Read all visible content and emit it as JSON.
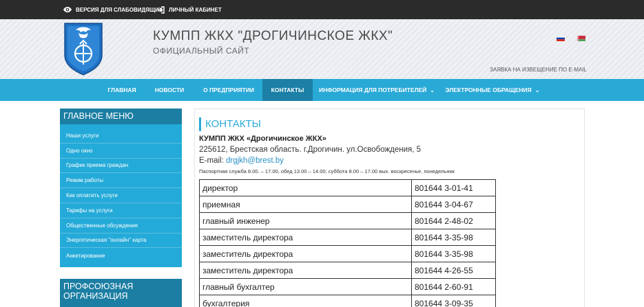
{
  "topbar": {
    "vision_label": "ВЕРСИЯ ДЛЯ СЛАБОВИДЯЩИХ",
    "cabinet_label": "ЛИЧНЫЙ КАБИНЕТ"
  },
  "header": {
    "title": "КУМПП ЖКХ \"ДРОГИЧИНСКОЕ ЖКХ\"",
    "subtitle": "ОФИЦИАЛЬНЫЙ САЙТ",
    "email_notice": "ЗАЯВКА НА ИЗВЕЩЕНИЕ ПО E-MAIL"
  },
  "nav": {
    "items": [
      {
        "label": "ГЛАВНАЯ"
      },
      {
        "label": "НОВОСТИ"
      },
      {
        "label": "О ПРЕДПРИЯТИИ"
      },
      {
        "label": "КОНТАКТЫ"
      },
      {
        "label": "ИНФОРМАЦИЯ ДЛЯ ПОТРЕБИТЕЛЕЙ"
      },
      {
        "label": "ЭЛЕКТРОННЫЕ ОБРАЩЕНИЯ"
      }
    ]
  },
  "sidebar": {
    "title": "ГЛАВНОЕ МЕНЮ",
    "items": [
      "Наши услуги",
      "Одно окно",
      "График приема граждан",
      "Режим работы",
      "Как оплатить услуги",
      "Тарифы на услуги",
      "Общественные обсуждения",
      "Энергетическая \"онлайн\" карта",
      "Анкетирование"
    ],
    "section2_title": "ПРОФСОЮЗНАЯ ОРГАНИЗАЦИЯ"
  },
  "content": {
    "title": "КОНТАКТЫ",
    "org": "КУМПП ЖКХ «Дрогичинское ЖКХ»",
    "address": "225612,  Брестская область. г.Дрогичин. ул.Освобождения, 5",
    "email_prefix": "E-mail: ",
    "email": "drgjkh@brest.by",
    "hours": "Паспортная служба 8.00. – 17.00, обед 13.00 – 14.00; суббота 8.00 – 17.00 вых. воскресенье,  понедельник",
    "rows": [
      {
        "position": "директор",
        "phone": "801644 3-01-41"
      },
      {
        "position": "приемная",
        "phone": "801644 3-04-67"
      },
      {
        "position": "главный инженер",
        "phone": "801644 2-48-02"
      },
      {
        "position": "заместитель директора",
        "phone": "801644 3-35-98"
      },
      {
        "position": "заместитель директора",
        "phone": "801644 3-35-98"
      },
      {
        "position": "заместитель директора",
        "phone": "801644 4-26-55"
      },
      {
        "position": "главный бухгалтер",
        "phone": "801644 2-60-91"
      },
      {
        "position": "бухгалтерия",
        "phone": "801644 3-09-35"
      }
    ]
  },
  "colors": {
    "topbar": "#2b2b2b",
    "nav": "#29a9d6",
    "nav_active": "#1b7fa6",
    "sidebar_head": "#1c7ea3",
    "sidebar_list": "#24aad8",
    "accent": "#29a9d6"
  },
  "icons": {
    "vision": "eye-icon",
    "cabinet": "sign-in-icon",
    "logo": "coat-of-arms",
    "flag_ru": "russian-flag",
    "flag_by": "belarus-flag",
    "dropdown": "chevron-down-icon"
  }
}
